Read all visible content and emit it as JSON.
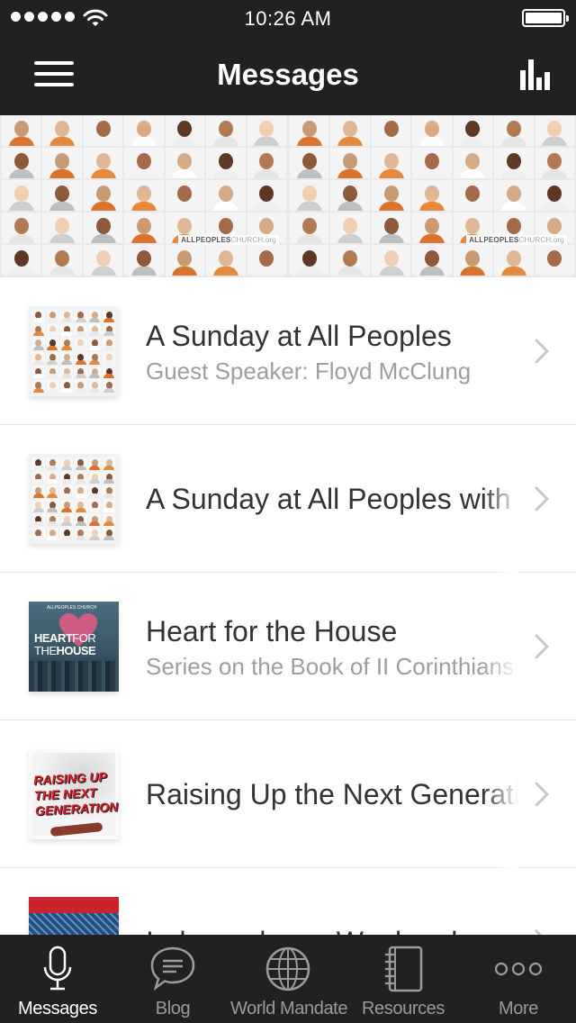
{
  "status_bar": {
    "time": "10:26 AM",
    "signal_dots": 5,
    "battery_level": 1.0,
    "icons": [
      "signal-dots-icon",
      "wifi-icon",
      "battery-icon"
    ]
  },
  "nav": {
    "title": "Messages",
    "left_icon": "menu-icon",
    "right_icon": "stats-icon"
  },
  "banner": {
    "logo_bold": "ALLPEOPLES",
    "logo_light": "CHURCH.org"
  },
  "messages": [
    {
      "title": "A Sunday at All Peoples",
      "subtitle": "Guest Speaker: Floyd McClung",
      "thumb": "faces"
    },
    {
      "title": "A Sunday at All Peoples with",
      "subtitle": "",
      "thumb": "faces"
    },
    {
      "title": "Heart for the House",
      "subtitle": "Series on the Book of II Corinthians",
      "thumb": "heart",
      "thumb_text": {
        "top": "ALLPEOPLES CHURCH",
        "line1_bold": "HEART",
        "line1_light": "FOR",
        "line2_light": "THE",
        "line2_bold": "HOUSE"
      }
    },
    {
      "title": "Raising Up the Next Generation",
      "subtitle": "",
      "thumb": "raise",
      "thumb_text": {
        "line1": "RAISING UP",
        "line2": "THE NEXT",
        "line3": "GENERATION"
      }
    },
    {
      "title": "Independence Weekend",
      "subtitle": "",
      "thumb": "independence"
    }
  ],
  "tabs": [
    {
      "label": "Messages",
      "icon": "microphone-icon",
      "active": true
    },
    {
      "label": "Blog",
      "icon": "speech-bubble-icon",
      "active": false
    },
    {
      "label": "World Mandate",
      "icon": "globe-icon",
      "active": false
    },
    {
      "label": "Resources",
      "icon": "notebook-icon",
      "active": false
    },
    {
      "label": "More",
      "icon": "more-dots-icon",
      "active": false
    }
  ],
  "colors": {
    "bar_background": "#212121",
    "tab_active": "#ffffff",
    "tab_inactive": "#9a9a9a",
    "title_text": "#333333",
    "subtitle_text": "#9e9e9e",
    "divider": "#e4e4e4"
  }
}
